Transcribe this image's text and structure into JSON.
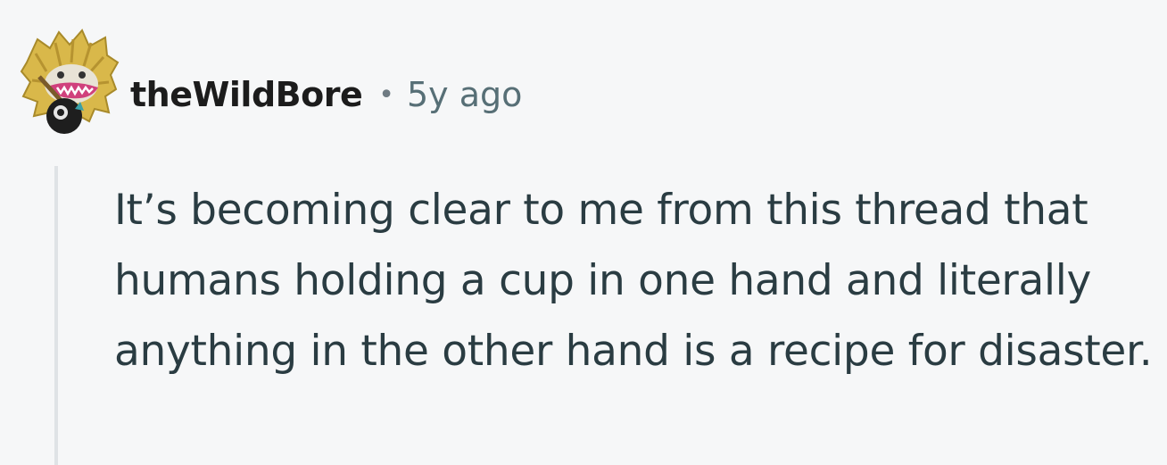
{
  "comment": {
    "author": "theWildBore",
    "separator": "•",
    "timestamp": "5y ago",
    "body": "It’s becoming clear to me from this thread that humans holding a cup in one hand and literally anything in the other hand is a recipe for disaster."
  },
  "colors": {
    "background": "#f6f7f8",
    "author_text": "#1c1c1c",
    "meta_text": "#576f76",
    "body_text": "#2a3c42",
    "thread_line": "#dfe3e6"
  },
  "icons": {
    "avatar": "furry-monster-avatar"
  }
}
